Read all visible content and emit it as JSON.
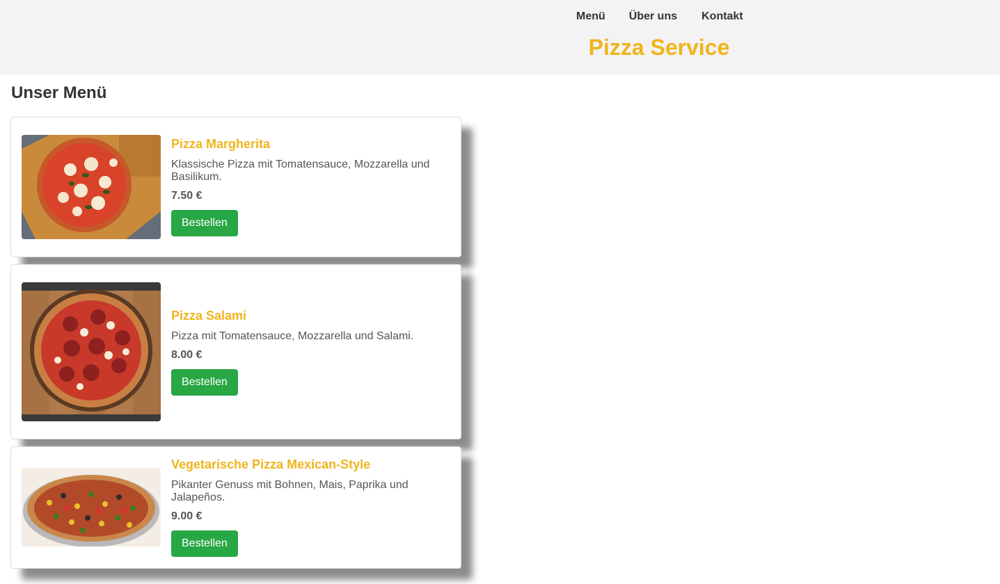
{
  "colors": {
    "accent": "#f0b41c",
    "button": "#28a745",
    "header_bg": "#f3f3f3"
  },
  "header": {
    "nav": [
      "Menü",
      "Über uns",
      "Kontakt"
    ],
    "title": "Pizza Service"
  },
  "main": {
    "title": "Unser Menü",
    "items": [
      {
        "name": "Pizza Margherita",
        "description": "Klassische Pizza mit Tomatensauce, Mozzarella und Basilikum.",
        "price": "7.50 €",
        "button": "Bestellen",
        "image_icon": "pizza-margherita-photo"
      },
      {
        "name": "Pizza Salami",
        "description": "Pizza mit Tomatensauce, Mozzarella und Salami.",
        "price": "8.00 €",
        "button": "Bestellen",
        "image_icon": "pizza-salami-photo"
      },
      {
        "name": "Vegetarische Pizza Mexican-Style",
        "description": "Pikanter Genuss mit Bohnen, Mais, Paprika und Jalapeños.",
        "price": "9.00 €",
        "button": "Bestellen",
        "image_icon": "pizza-mexican-photo"
      }
    ]
  }
}
